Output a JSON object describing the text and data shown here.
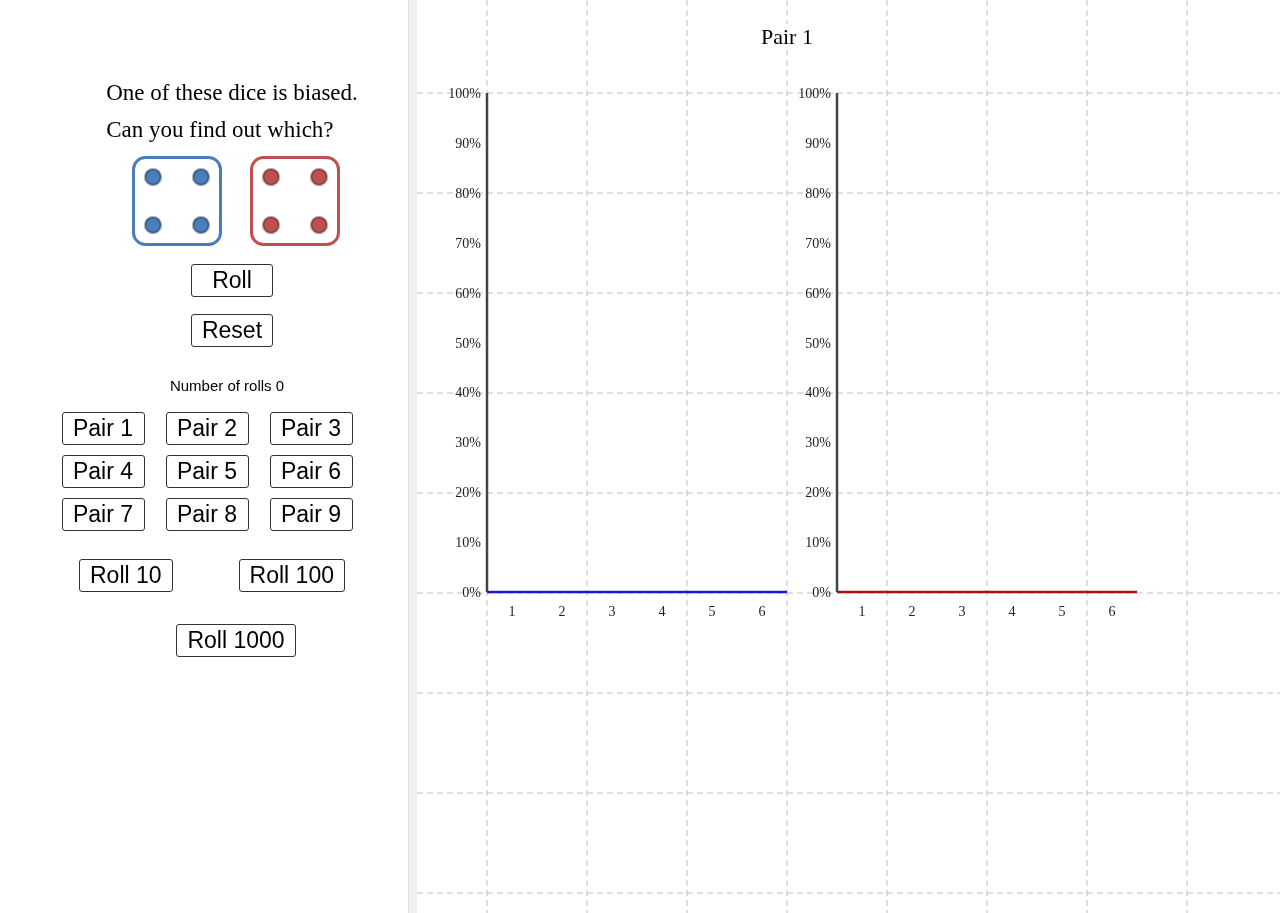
{
  "intro": [
    "One of these dice is biased.",
    "Can you find out which?"
  ],
  "dice": [
    {
      "color": "#4a7ebb"
    },
    {
      "color": "#c0504d"
    }
  ],
  "controls": [
    "Roll",
    "Reset"
  ],
  "roll_count": "Number of rolls 0",
  "pairs": [
    "Pair 1",
    "Pair 2",
    "Pair 3",
    "Pair 4",
    "Pair 5",
    "Pair 6",
    "Pair 7",
    "Pair 8",
    "Pair 9"
  ],
  "roll_buttons": [
    "Roll 10",
    "Roll 100"
  ],
  "roll_1000": "Roll 1000",
  "graph": {
    "title": "Pair 1",
    "charts": [
      {
        "chart_data": {
          "type": "bar",
          "categories": [
            "1",
            "2",
            "3",
            "4",
            "5",
            "6"
          ],
          "series": [
            {
              "color": "#1a1acc",
              "values": [
                0,
                0,
                0,
                0,
                0,
                0
              ]
            }
          ],
          "ylim": [
            0,
            1
          ],
          "yticks": [
            {
              "value": 1,
              "label": "100%"
            },
            {
              "value": 0.9,
              "label": "90%"
            },
            {
              "value": 0.8,
              "label": "80%"
            },
            {
              "value": 0.7,
              "label": "70%"
            },
            {
              "value": 0.6,
              "label": "60%"
            },
            {
              "value": 0.5,
              "label": "50%"
            },
            {
              "value": 0.4,
              "label": "40%"
            },
            {
              "value": 0.3,
              "label": "30%"
            },
            {
              "value": 0.2,
              "label": "20%"
            },
            {
              "value": 0.1,
              "label": "10%"
            },
            {
              "value": 0,
              "label": "0%"
            }
          ]
        }
      },
      {
        "chart_data": {
          "type": "bar",
          "categories": [
            "1",
            "2",
            "3",
            "4",
            "5",
            "6"
          ],
          "series": [
            {
              "color": "#aa1111",
              "values": [
                0,
                0,
                0,
                0,
                0,
                0
              ]
            }
          ],
          "ylim": [
            0,
            1
          ],
          "yticks": [
            {
              "value": 1,
              "label": "100%"
            },
            {
              "value": 0.9,
              "label": "90%"
            },
            {
              "value": 0.8,
              "label": "80%"
            },
            {
              "value": 0.7,
              "label": "70%"
            },
            {
              "value": 0.6,
              "label": "60%"
            },
            {
              "value": 0.5,
              "label": "50%"
            },
            {
              "value": 0.4,
              "label": "40%"
            },
            {
              "value": 0.3,
              "label": "30%"
            },
            {
              "value": 0.2,
              "label": "20%"
            },
            {
              "value": 0.1,
              "label": "10%"
            },
            {
              "value": 0,
              "label": "0%"
            }
          ]
        }
      }
    ]
  }
}
